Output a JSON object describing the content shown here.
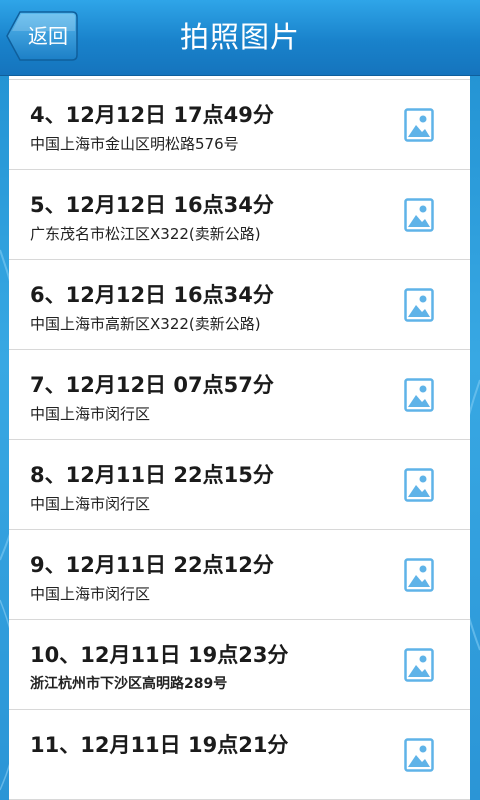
{
  "header": {
    "back_label": "返回",
    "title": "拍照图片"
  },
  "records": [
    {
      "title": "4、12月12日  17点49分",
      "address": "中国上海市金山区明松路576号",
      "bold_address": false
    },
    {
      "title": "5、12月12日  16点34分",
      "address": " 广东茂名市松江区X322(卖新公路)",
      "bold_address": false
    },
    {
      "title": "6、12月12日  16点34分",
      "address": "中国上海市高新区X322(卖新公路)",
      "bold_address": false
    },
    {
      "title": "7、12月12日  07点57分",
      "address": "中国上海市闵行区",
      "bold_address": false
    },
    {
      "title": "8、12月11日  22点15分",
      "address": "中国上海市闵行区",
      "bold_address": false
    },
    {
      "title": "9、12月11日  22点12分",
      "address": "中国上海市闵行区",
      "bold_address": false
    },
    {
      "title": "10、12月11日  19点23分",
      "address": " 浙江杭州市下沙区高明路289号",
      "bold_address": true
    },
    {
      "title": "11、12月11日  19点21分",
      "address": "",
      "bold_address": false
    }
  ],
  "icons": {
    "back": "back-arrow-button",
    "photo": "image-icon"
  },
  "colors": {
    "header": "#1982cb",
    "background": "#38a8e3",
    "icon": "#5fb3e8"
  }
}
